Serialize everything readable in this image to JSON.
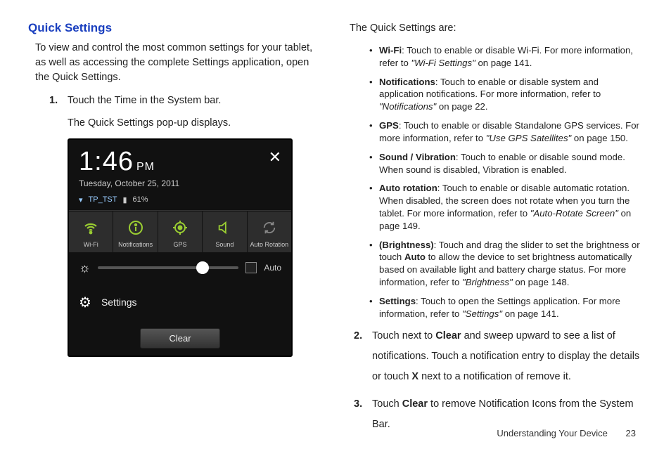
{
  "header": "Quick Settings",
  "intro": "To view and control the most common settings for your tablet, as well as accessing the complete Settings application, open the Quick Settings.",
  "step1_num": "1.",
  "step1_a": "Touch the Time in the System bar.",
  "step1_b": "The Quick Settings pop-up displays.",
  "right_intro": "The Quick Settings are:",
  "bullets": {
    "wifi": {
      "label": "Wi-Fi",
      "text": ": Touch to enable or disable Wi-Fi. For more information, refer to ",
      "ref": "\"Wi-Fi Settings\"",
      "tail": " on page 141."
    },
    "notif": {
      "label": "Notifications",
      "text": ": Touch to enable or disable system and application notifications. For more information, refer to ",
      "ref": "\"Notifications\"",
      "tail": " on page 22."
    },
    "gps": {
      "label": "GPS",
      "text": ": Touch to enable or disable Standalone GPS services. For more information, refer to ",
      "ref": "\"Use GPS Satellites\"",
      "tail": " on page 150."
    },
    "sound": {
      "label": "Sound / Vibration",
      "text": ": Touch to enable or disable sound mode. When sound is disabled, Vibration is enabled."
    },
    "rot": {
      "label": "Auto rotation",
      "text": ": Touch to enable or disable automatic rotation. When disabled, the screen does not rotate when you turn the tablet. For more information, refer to ",
      "ref": "\"Auto-Rotate Screen\"",
      "tail": " on page 149."
    },
    "bright": {
      "label": "(Brightness)",
      "text1": ": Touch and drag the slider to set the brightness or touch ",
      "bold": "Auto",
      "text2": " to allow the device to set brightness automatically based on available light and battery charge status. For more information, refer to ",
      "ref": "\"Brightness\"",
      "tail": " on page 148."
    },
    "settings": {
      "label": "Settings",
      "text": ": Touch to open the Settings application. For more information, refer to ",
      "ref": "\"Settings\"",
      "tail": " on page 141."
    }
  },
  "step2_num": "2.",
  "step2_a": "Touch next to ",
  "step2_b": "Clear",
  "step2_c": " and sweep upward to see a list of notifications. Touch a notification entry to display the details or touch ",
  "step2_d": "X",
  "step2_e": " next to a notification of remove it.",
  "step3_num": "3.",
  "step3_a": "Touch ",
  "step3_b": "Clear",
  "step3_c": " to remove Notification Icons from the System Bar.",
  "footer_section": "Understanding Your Device",
  "footer_page": "23",
  "device": {
    "time": "1:46",
    "ampm": "PM",
    "date": "Tuesday, October 25, 2011",
    "ssid": "TP_TST",
    "battery": "61%",
    "tiles": {
      "wifi": "Wi-Fi",
      "notif": "Notifications",
      "gps": "GPS",
      "sound": "Sound",
      "rot": "Auto Rotation"
    },
    "auto": "Auto",
    "settings": "Settings",
    "clear": "Clear"
  }
}
